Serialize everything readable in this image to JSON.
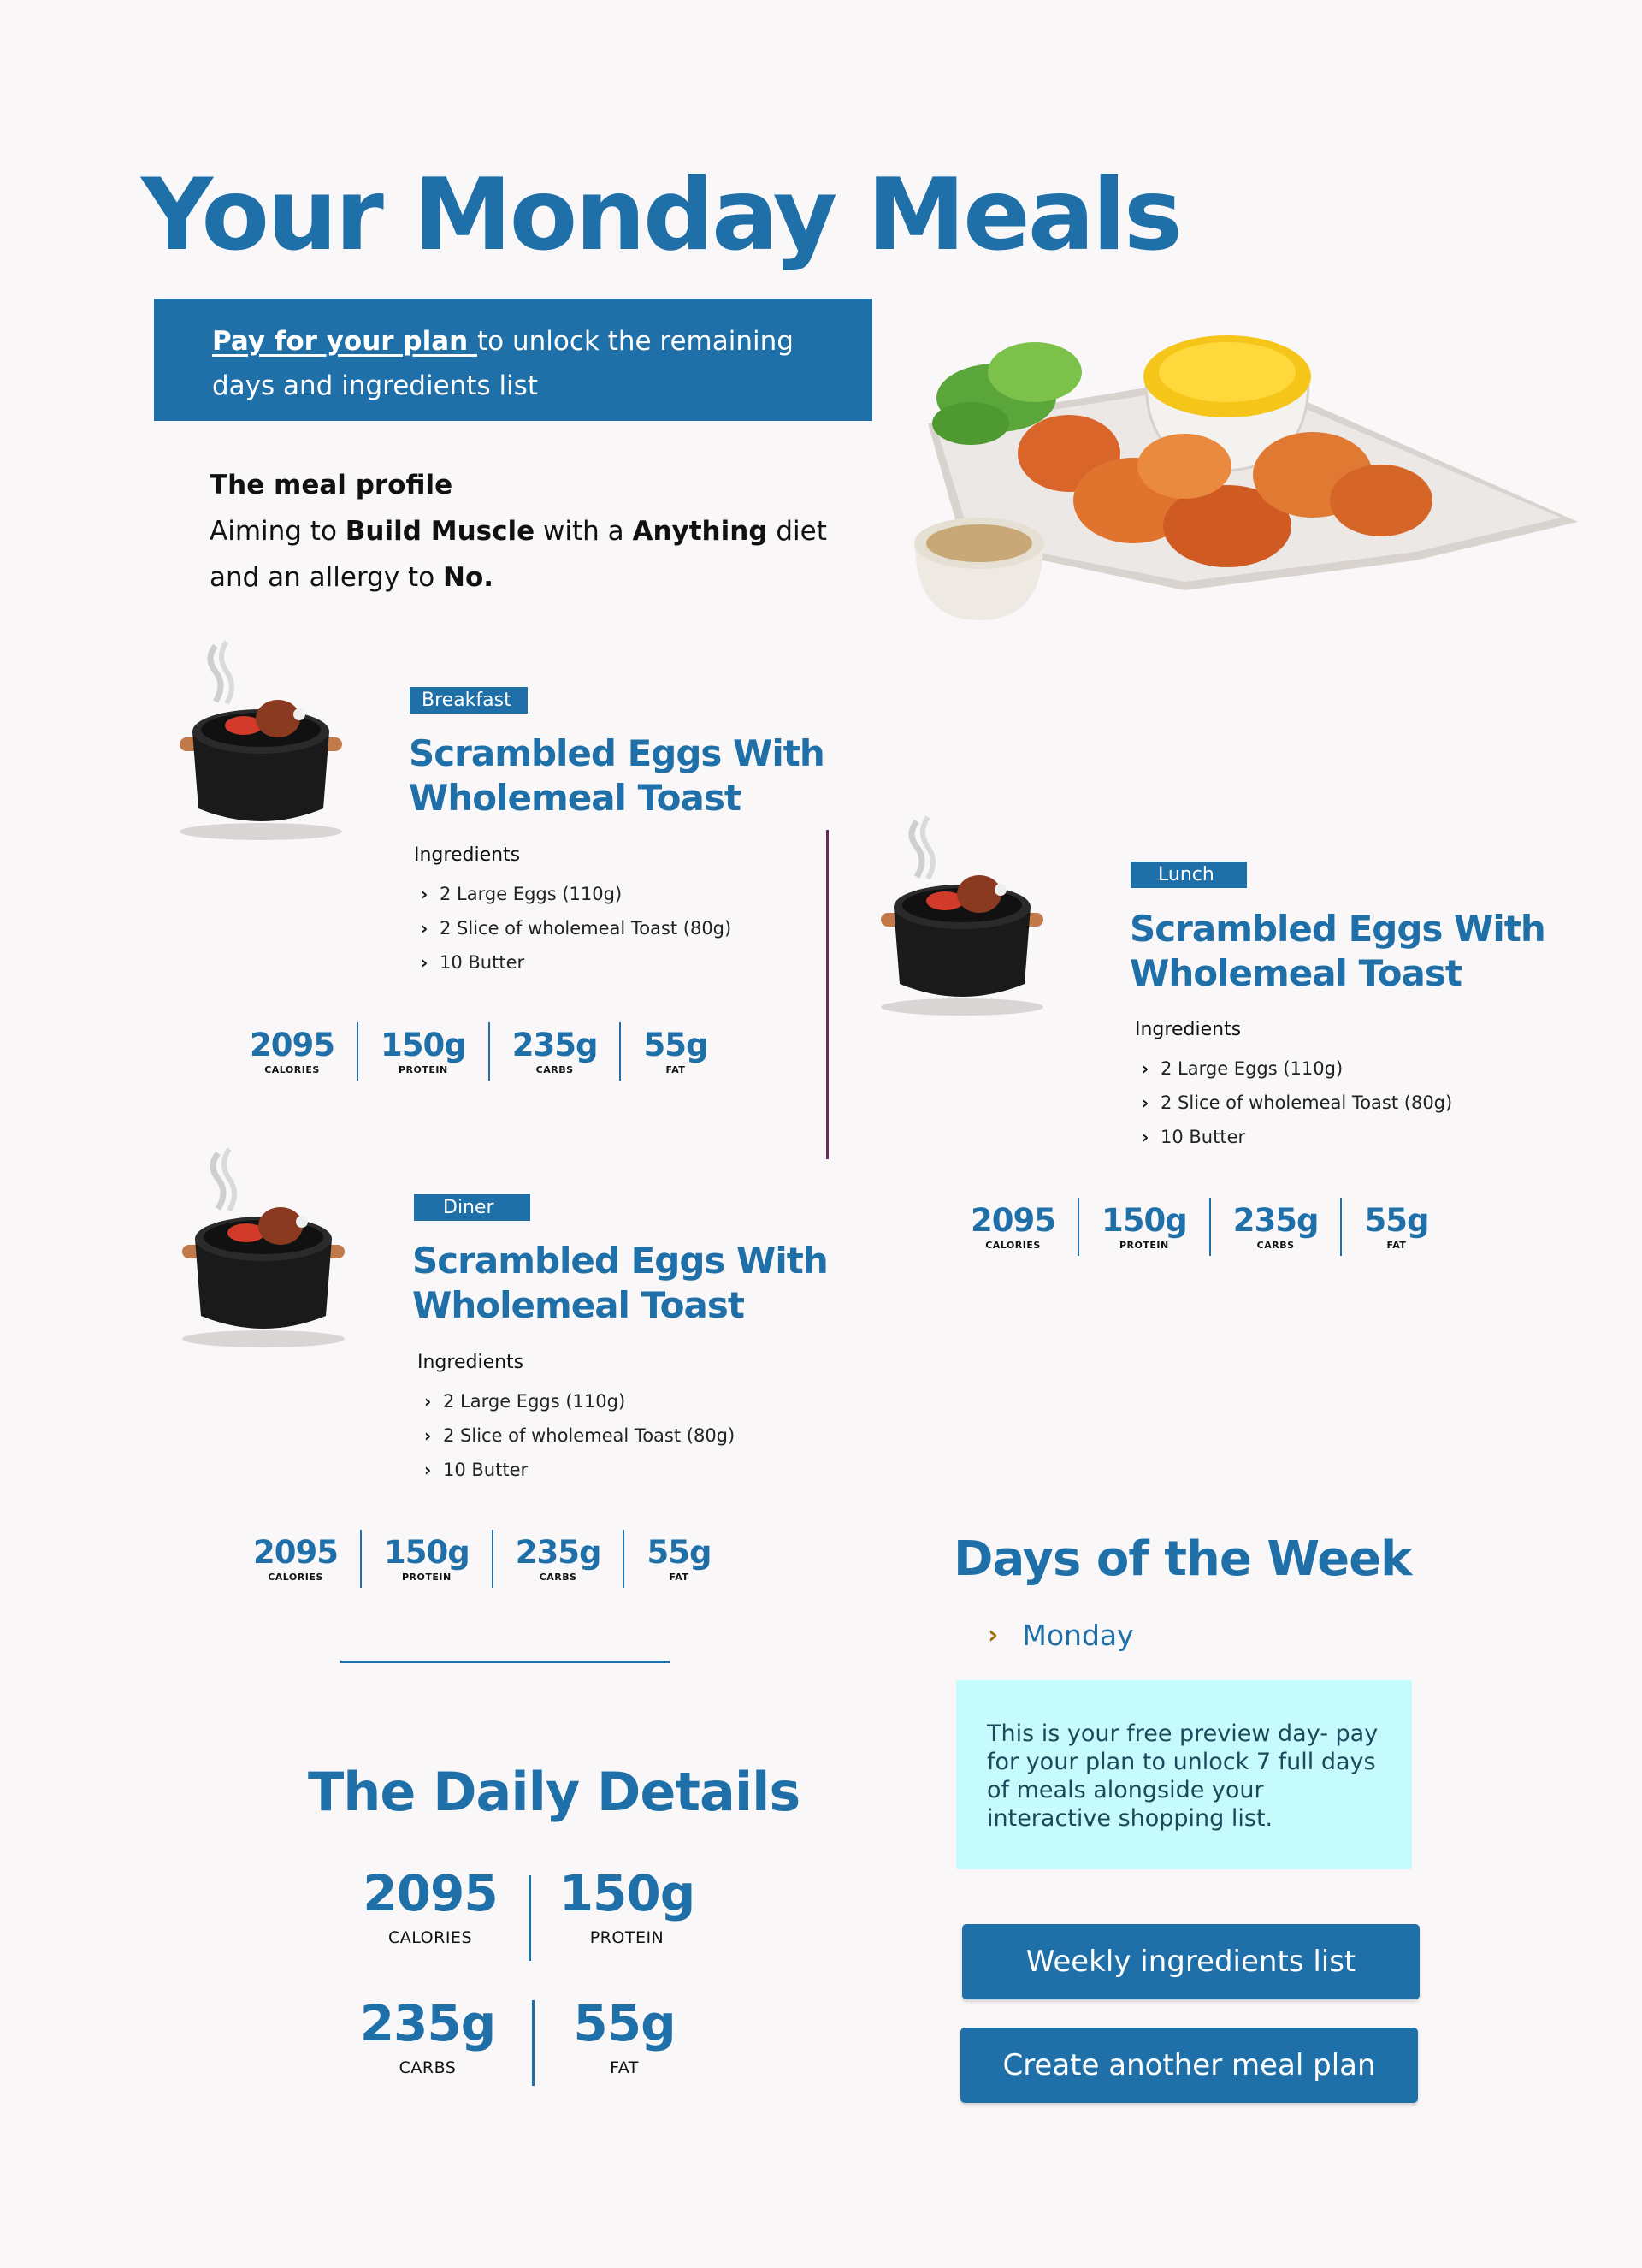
{
  "page": {
    "title": "Your Monday Meals",
    "unlock_link": "Pay for your plan ",
    "unlock_text": "to unlock the remaining days and ingredients list"
  },
  "profile": {
    "heading": "The meal profile",
    "line1_a": "Aiming to ",
    "goal": "Build Muscle",
    "line1_b": " with a ",
    "diet": "Anything",
    "line1_c": " diet",
    "line2_a": "and an allergy to ",
    "allergy": "No."
  },
  "meals": [
    {
      "tag": "Breakfast",
      "name_line1": "Scrambled Eggs With",
      "name_line2": "Wholemeal Toast",
      "ingredients_heading": "Ingredients",
      "ingredients": [
        "2 Large Eggs (110g)",
        "2 Slice of wholemeal Toast (80g)",
        "10 Butter"
      ],
      "macros": [
        {
          "value": "2095",
          "label": "CALORIES"
        },
        {
          "value": "150g",
          "label": "PROTEIN"
        },
        {
          "value": "235g",
          "label": "CARBS"
        },
        {
          "value": "55g",
          "label": "FAT"
        }
      ]
    },
    {
      "tag": "Lunch",
      "name_line1": "Scrambled Eggs With",
      "name_line2": "Wholemeal Toast",
      "ingredients_heading": "Ingredients",
      "ingredients": [
        "2 Large Eggs (110g)",
        "2 Slice of wholemeal Toast (80g)",
        "10 Butter"
      ],
      "macros": [
        {
          "value": "2095",
          "label": "CALORIES"
        },
        {
          "value": "150g",
          "label": "PROTEIN"
        },
        {
          "value": "235g",
          "label": "CARBS"
        },
        {
          "value": "55g",
          "label": "FAT"
        }
      ]
    },
    {
      "tag": "Diner",
      "name_line1": "Scrambled Eggs With",
      "name_line2": "Wholemeal Toast",
      "ingredients_heading": "Ingredients",
      "ingredients": [
        "2 Large Eggs (110g)",
        "2 Slice of wholemeal Toast (80g)",
        "10 Butter"
      ],
      "macros": [
        {
          "value": "2095",
          "label": "CALORIES"
        },
        {
          "value": "150g",
          "label": "PROTEIN"
        },
        {
          "value": "235g",
          "label": "CARBS"
        },
        {
          "value": "55g",
          "label": "FAT"
        }
      ]
    }
  ],
  "daily": {
    "title": "The Daily Details",
    "stats": [
      {
        "value": "2095",
        "label": "CALORIES"
      },
      {
        "value": "150g",
        "label": "PROTEIN"
      },
      {
        "value": "235g",
        "label": "CARBS"
      },
      {
        "value": "55g",
        "label": "FAT"
      }
    ]
  },
  "week": {
    "title": "Days of the Week",
    "days": [
      "Monday"
    ],
    "preview_text": "This is your free preview day- pay for your plan to unlock 7 full days of meals alongside your interactive shopping list."
  },
  "buttons": {
    "ingredients": "Weekly ingredients list",
    "new_plan": "Create another meal plan"
  },
  "colors": {
    "brand_blue": "#1f6fa8",
    "preview_bg": "#c5fbfc",
    "divider_purple": "#6b2a5e"
  },
  "icons": [
    "cooking-pot-icon",
    "chevron-right-icon"
  ]
}
